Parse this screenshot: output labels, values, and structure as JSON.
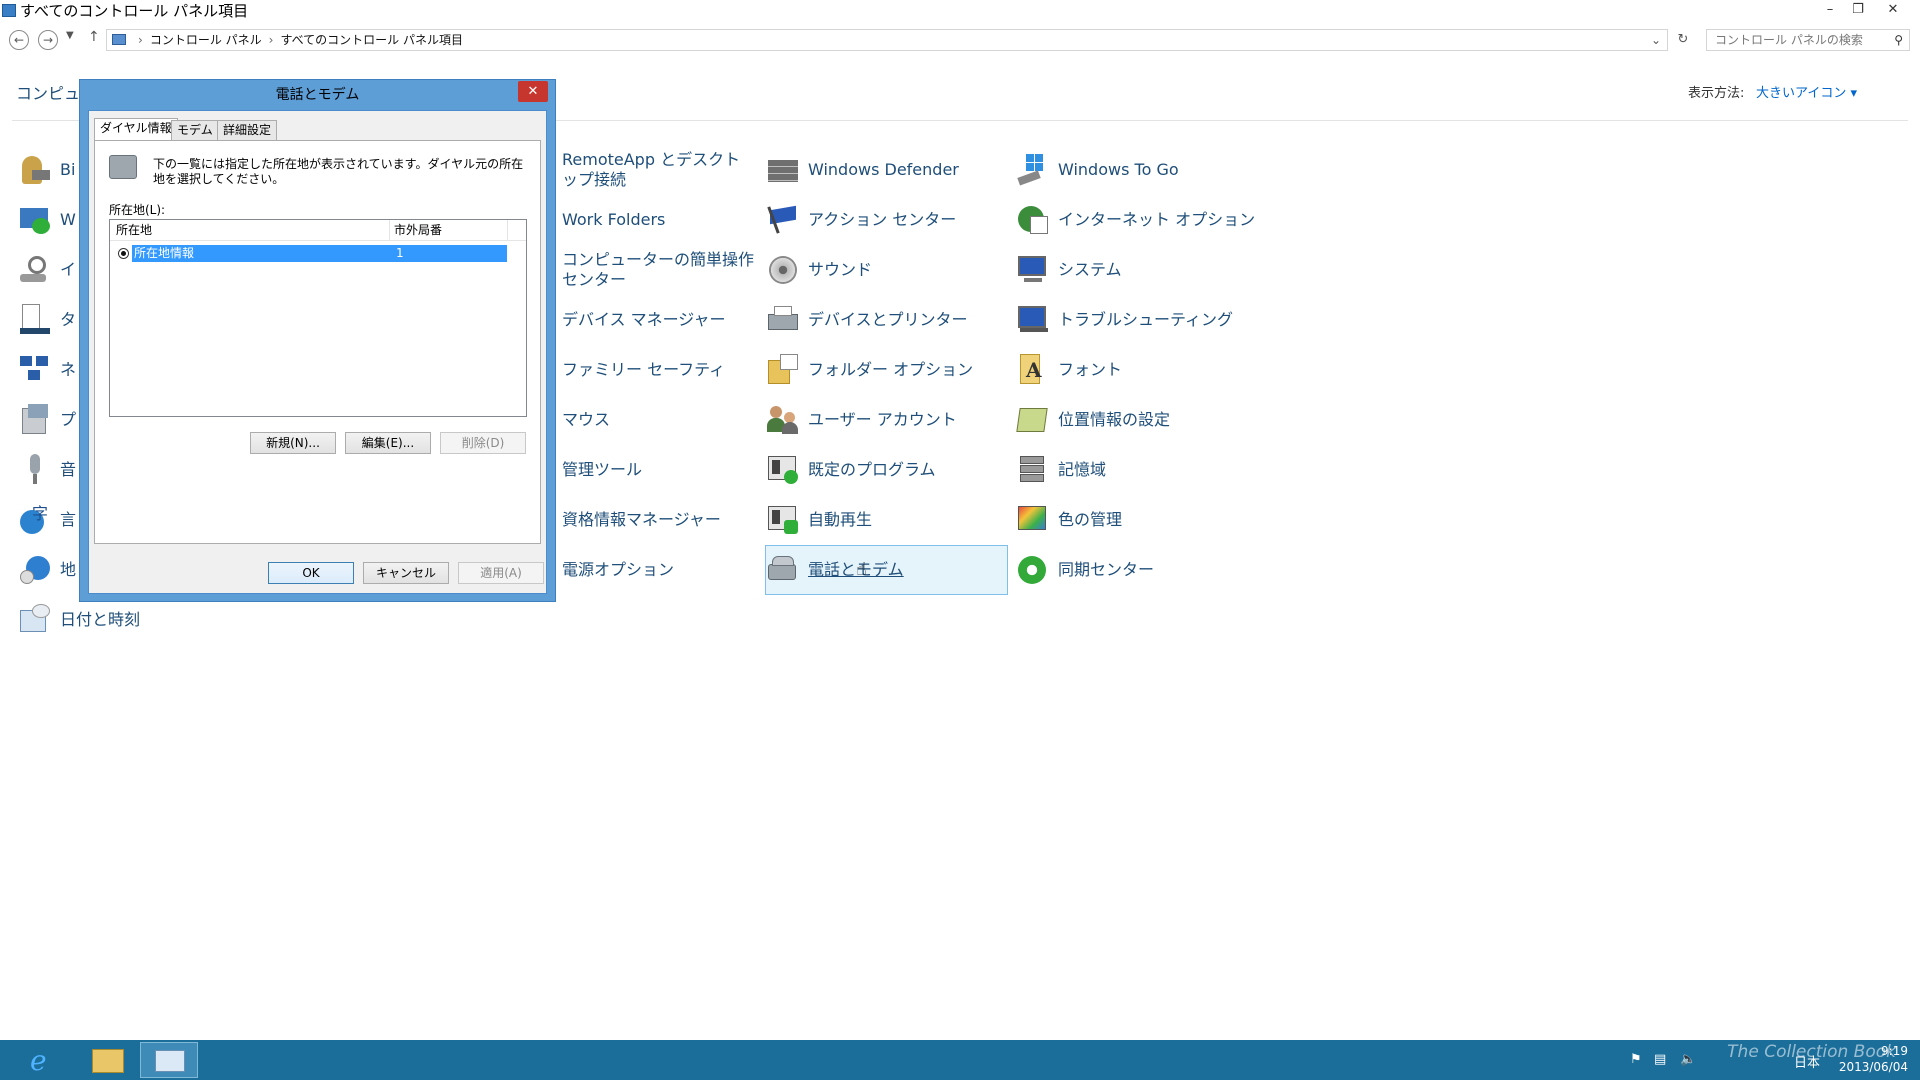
{
  "window": {
    "title": "すべてのコントロール パネル項目",
    "minimize": "–",
    "restore": "❐",
    "close": "✕"
  },
  "address": {
    "crumbs": [
      "コントロール パネル",
      "すべてのコントロール パネル項目"
    ],
    "search_placeholder": "コントロール パネルの検索"
  },
  "header": {
    "heading": "コンピュー",
    "view_label": "表示方法:",
    "view_value": "大きいアイコン ▾"
  },
  "items": {
    "col1": [
      {
        "label": "Bi",
        "icon": "bitlocker-icon"
      },
      {
        "label": "W",
        "icon": "windows-update-icon"
      },
      {
        "label": "イ",
        "icon": "indexing-icon"
      },
      {
        "label": "タ",
        "icon": "taskbar-icon"
      },
      {
        "label": "ネ",
        "icon": "network-icon"
      },
      {
        "label": "プ",
        "icon": "programs-icon"
      },
      {
        "label": "音",
        "icon": "speech-icon"
      },
      {
        "label": "言",
        "icon": "language-icon"
      },
      {
        "label": "地",
        "icon": "region-icon"
      },
      {
        "label": "日付と時刻",
        "icon": "date-time-icon"
      }
    ],
    "col2": [
      {
        "label": "RemoteApp とデスクトップ接続",
        "icon": "remoteapp-icon"
      },
      {
        "label": "Work Folders",
        "icon": "work-folders-icon"
      },
      {
        "label": "コンピューターの簡単操作センター",
        "icon": "ease-of-access-icon"
      },
      {
        "label": "デバイス マネージャー",
        "icon": "device-manager-icon"
      },
      {
        "label": "ファミリー セーフティ",
        "icon": "family-safety-icon"
      },
      {
        "label": "マウス",
        "icon": "mouse-icon"
      },
      {
        "label": "管理ツール",
        "icon": "admin-tools-icon"
      },
      {
        "label": "資格情報マネージャー",
        "icon": "credential-manager-icon"
      },
      {
        "label": "電源オプション",
        "icon": "power-options-icon"
      }
    ],
    "col3": [
      {
        "label": "Windows Defender",
        "icon": "defender-icon"
      },
      {
        "label": "アクション センター",
        "icon": "action-center-icon"
      },
      {
        "label": "サウンド",
        "icon": "sound-icon"
      },
      {
        "label": "デバイスとプリンター",
        "icon": "devices-printers-icon"
      },
      {
        "label": "フォルダー オプション",
        "icon": "folder-options-icon"
      },
      {
        "label": "ユーザー アカウント",
        "icon": "user-accounts-icon"
      },
      {
        "label": "既定のプログラム",
        "icon": "default-programs-icon"
      },
      {
        "label": "自動再生",
        "icon": "autoplay-icon"
      },
      {
        "label": "電話とモデム",
        "icon": "phone-modem-icon"
      }
    ],
    "col4": [
      {
        "label": "Windows To Go",
        "icon": "windows-to-go-icon"
      },
      {
        "label": "インターネット オプション",
        "icon": "internet-options-icon"
      },
      {
        "label": "システム",
        "icon": "system-icon"
      },
      {
        "label": "トラブルシューティング",
        "icon": "troubleshooting-icon"
      },
      {
        "label": "フォント",
        "icon": "fonts-icon"
      },
      {
        "label": "位置情報の設定",
        "icon": "location-icon"
      },
      {
        "label": "記憶域",
        "icon": "storage-spaces-icon"
      },
      {
        "label": "色の管理",
        "icon": "color-management-icon"
      },
      {
        "label": "同期センター",
        "icon": "sync-center-icon"
      }
    ]
  },
  "dialog": {
    "title": "電話とモデム",
    "close": "✕",
    "tabs": [
      "ダイヤル情報",
      "モデム",
      "詳細設定"
    ],
    "description": "下の一覧には指定した所在地が表示されています。ダイヤル元の所在地を選択してください。",
    "locations_label": "所在地(L):",
    "columns": [
      "所在地",
      "市外局番"
    ],
    "rows": [
      {
        "location": "所在地情報",
        "area_code": "1"
      }
    ],
    "new_button": "新規(N)...",
    "edit_button": "編集(E)...",
    "delete_button": "削除(D)",
    "ok_button": "OK",
    "cancel_button": "キャンセル",
    "apply_button": "適用(A)"
  },
  "taskbar": {
    "ime": "日本",
    "time": "9:19",
    "date": "2013/06/04",
    "watermark": "The Collection Book"
  },
  "colors": {
    "link": "#1e4e79",
    "dialog_frame": "#5e9ed6",
    "selection": "#3399ff",
    "taskbar": "#1b6d9a"
  }
}
